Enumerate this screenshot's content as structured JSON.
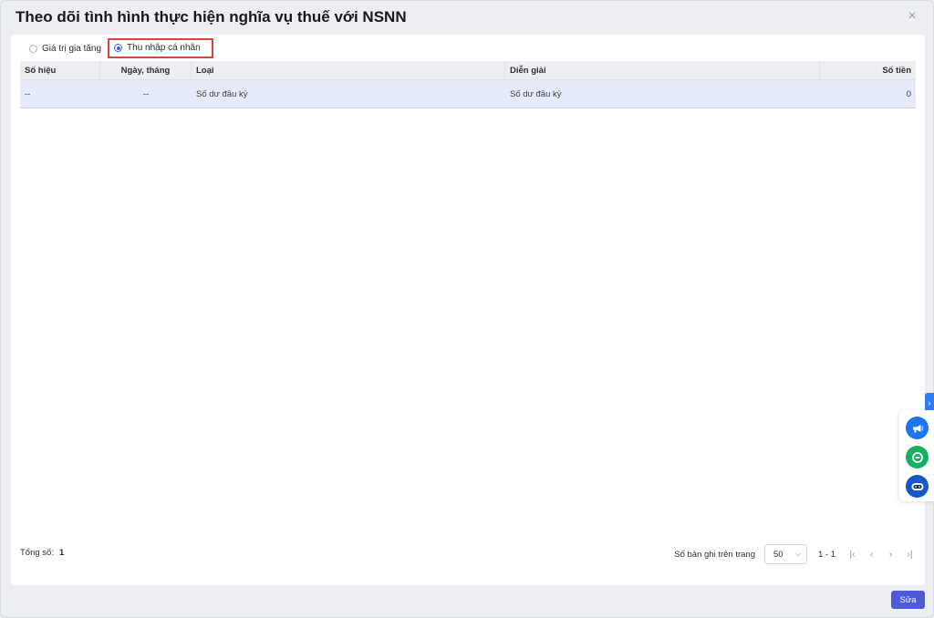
{
  "dialog": {
    "title": "Theo dõi tình hình thực hiện nghĩa vụ thuế với NSNN",
    "close_symbol": "×"
  },
  "tax_type": {
    "options": [
      {
        "label": "Giá trị gia tăng",
        "checked": false
      },
      {
        "label": "Thu nhập cá nhân",
        "checked": true
      }
    ]
  },
  "table": {
    "columns": [
      "Số hiệu",
      "Ngày, tháng",
      "Loại",
      "Diễn giải",
      "Số tiền"
    ],
    "rows": [
      {
        "so_hieu": "--",
        "ngay_thang": "--",
        "loai": "Số dư đầu kỳ",
        "dien_giai": "Số dư đầu kỳ",
        "so_tien": "0"
      }
    ]
  },
  "footer": {
    "total_label": "Tổng số:",
    "total_value": "1",
    "page_size_label": "Số bản ghi trên trang",
    "page_size_value": "50",
    "range_text": "1 - 1"
  },
  "actions": {
    "save_label": "Sửa"
  },
  "colors": {
    "accent": "#4e5bd8",
    "highlight_border": "#d9473b",
    "selected_row": "#e6ebfb"
  },
  "icons": {
    "side_panel": "chevron-right-icon",
    "fab1": "megaphone-icon",
    "fab2": "chat-icon",
    "fab3": "robot-icon"
  }
}
